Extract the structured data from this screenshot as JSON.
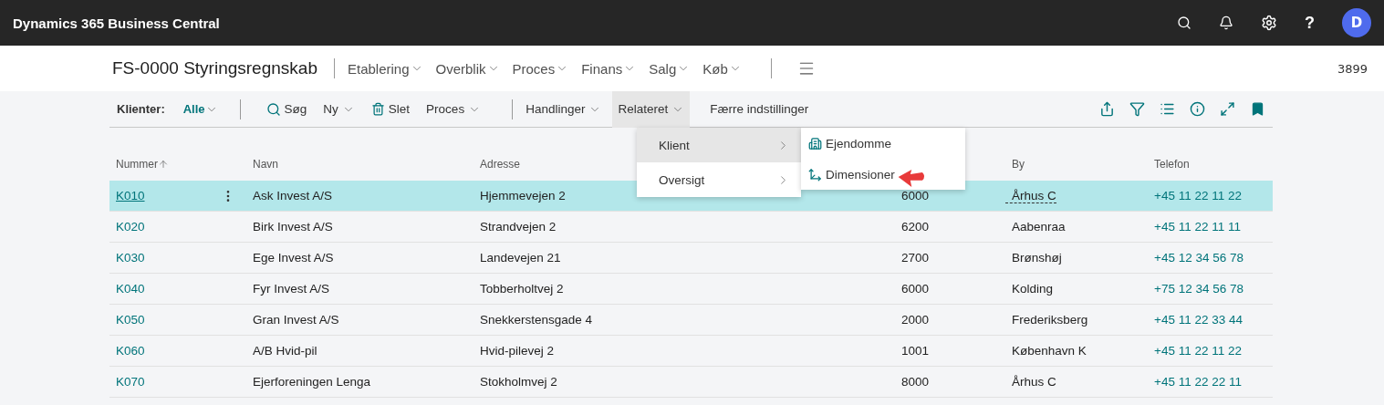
{
  "app_bar": {
    "title": "Dynamics 365 Business Central",
    "avatar": "D",
    "help": "?"
  },
  "header": {
    "title": "FS-0000 Styringsregnskab",
    "menus": [
      {
        "label": "Etablering"
      },
      {
        "label": "Overblik"
      },
      {
        "label": "Proces"
      },
      {
        "label": "Finans"
      },
      {
        "label": "Salg"
      },
      {
        "label": "Køb"
      }
    ],
    "company_number": "3899"
  },
  "action_bar": {
    "filter_label": "Klienter:",
    "filter_value": "Alle",
    "actions": [
      {
        "label": "Søg",
        "kind": "search",
        "expanded": false
      },
      {
        "label": "Ny",
        "kind": "dropdown",
        "expanded": false
      },
      {
        "label": "Slet",
        "kind": "delete",
        "expanded": false
      },
      {
        "label": "Proces",
        "kind": "dropdown",
        "expanded": false
      },
      {
        "label": "Handlinger",
        "kind": "dropdown",
        "expanded": false
      },
      {
        "label": "Relateret",
        "kind": "dropdown",
        "expanded": true
      },
      {
        "label": "Færre indstillinger",
        "kind": "plain",
        "expanded": false
      }
    ]
  },
  "menu": {
    "items": [
      {
        "label": "Klient",
        "selected": true
      },
      {
        "label": "Oversigt",
        "selected": false
      }
    ],
    "submenu": [
      {
        "label": "Ejendomme",
        "kind": "building"
      },
      {
        "label": "Dimensioner",
        "kind": "dimensions"
      }
    ]
  },
  "table": {
    "columns": [
      "Nummer",
      "Navn",
      "Adresse",
      "By",
      "Telefon"
    ],
    "rows": [
      {
        "number": "K010",
        "name": "Ask Invest A/S",
        "address": "Hjemmevejen 2",
        "postcode": "6000",
        "city": "Århus C",
        "phone": "+45 11 22 11 22",
        "selected": true
      },
      {
        "number": "K020",
        "name": "Birk Invest A/S",
        "address": "Strandvejen 2",
        "postcode": "6200",
        "city": "Aabenraa",
        "phone": "+45 11 22 11 11",
        "selected": false
      },
      {
        "number": "K030",
        "name": "Ege Invest A/S",
        "address": "Landevejen 21",
        "postcode": "2700",
        "city": "Brønshøj",
        "phone": "+45 12 34 56 78",
        "selected": false
      },
      {
        "number": "K040",
        "name": "Fyr Invest A/S",
        "address": "Tobberholtvej 2",
        "postcode": "6000",
        "city": "Kolding",
        "phone": "+75 12 34 56 78",
        "selected": false
      },
      {
        "number": "K050",
        "name": "Gran Invest A/S",
        "address": "Snekkerstensgade 4",
        "postcode": "2000",
        "city": "Frederiksberg",
        "phone": "+45 11 22 33 44",
        "selected": false
      },
      {
        "number": "K060",
        "name": "A/B Hvid-pil",
        "address": "Hvid-pilevej 2",
        "postcode": "1001",
        "city": "København K",
        "phone": "+45 11 22 11 22",
        "selected": false
      },
      {
        "number": "K070",
        "name": "Ejerforeningen Lenga",
        "address": "Stokholmvej 2",
        "postcode": "8000",
        "city": "Århus C",
        "phone": "+45 11 22 22 11",
        "selected": false
      }
    ]
  }
}
